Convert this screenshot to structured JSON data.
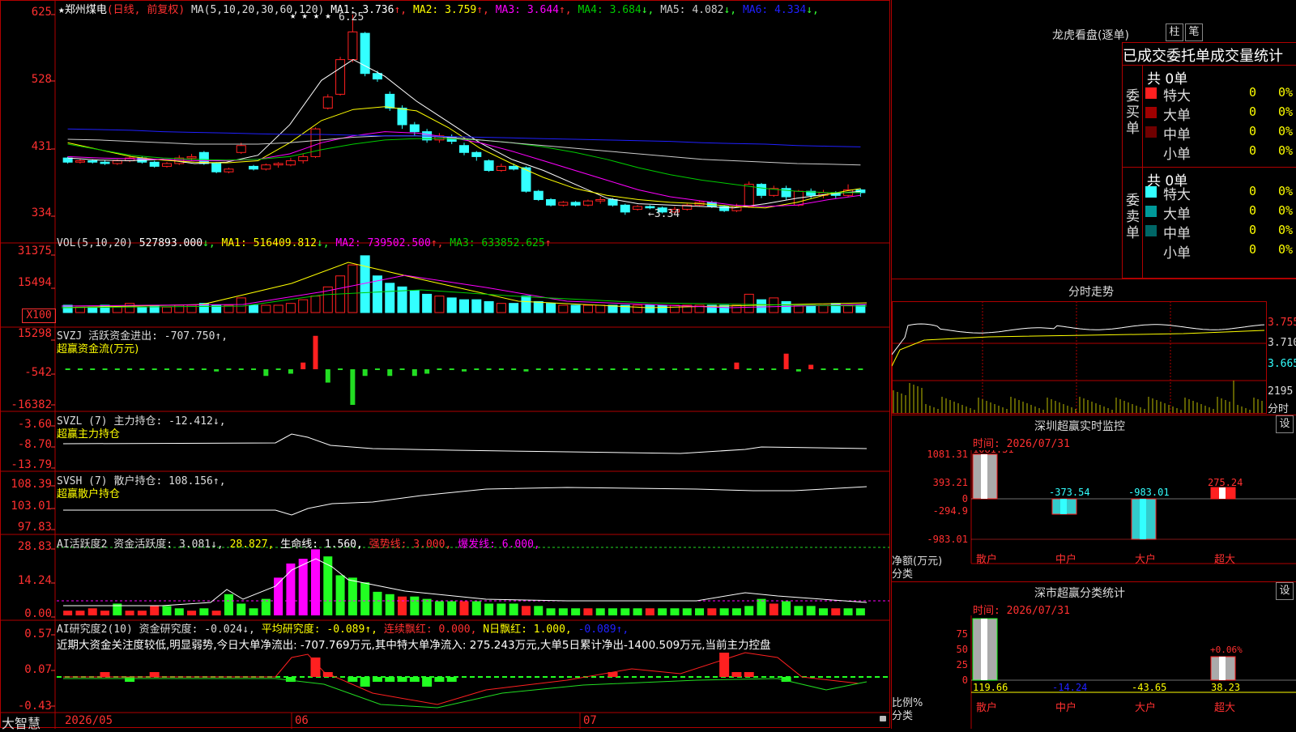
{
  "colors": {
    "up": "#ff2020",
    "down": "#33ffff",
    "axis": "#ff3030",
    "grid": "#b00000",
    "ma1": "#ffffff",
    "ma2": "#ffff00",
    "ma3": "#ff00ff",
    "ma4": "#00cc00",
    "ma5": "#cccccc",
    "ma6": "#2020ff"
  },
  "main": {
    "star": "★",
    "stock": "郑州煤电",
    "mode": "(日线, 前复权)",
    "ma_label": "MA(5,10,20,30,60,120)",
    "ma": [
      {
        "k": "MA1:",
        "v": "3.736",
        "a": "↑",
        "c": "#ffffff"
      },
      {
        "k": "MA2:",
        "v": "3.759",
        "a": "↑",
        "c": "#ffff00"
      },
      {
        "k": "MA3:",
        "v": "3.644",
        "a": "↑",
        "c": "#ff00ff"
      },
      {
        "k": "MA4:",
        "v": "3.684",
        "a": "↓",
        "c": "#00cc00"
      },
      {
        "k": "MA5:",
        "v": "4.082",
        "a": "↓",
        "c": "#cccccc"
      },
      {
        "k": "MA6:",
        "v": "4.334",
        "a": "↓",
        "c": "#2020ff"
      }
    ],
    "yticks": [
      "625",
      "528",
      "431",
      "334"
    ],
    "high_mark": "6.25",
    "low_mark": "←3.34",
    "stars": "★ ★ ★ ★"
  },
  "vol": {
    "label": "VOL(5,10,20)",
    "v": "527893.000",
    "ma1": "MA1: 516409.812",
    "ma2": "MA2: 739502.500",
    "ma3": "MA3: 633852.625",
    "yticks": [
      "31375",
      "15494"
    ],
    "unit": "X100"
  },
  "svzj": {
    "label": "SVZJ  活跃资金进出: -707.750↑,",
    "sub": "超赢资金流(万元)",
    "yticks": [
      "15298",
      "-542",
      "-16382"
    ]
  },
  "svzl": {
    "label": "SVZL (7) 主力持仓: -12.412↓,",
    "sub": "超赢主力持仓",
    "yticks": [
      "-3.60",
      "-8.70",
      "-13.79"
    ]
  },
  "svsh": {
    "label": "SVSH (7) 散户持仓: 108.156↑,",
    "sub": "超赢散户持仓",
    "yticks": [
      "108.39",
      "103.01",
      "97.83"
    ]
  },
  "ai": {
    "label": "AI活跃度2 资金活跃度: 3.081↓,",
    "v2": "28.827,",
    "life": "生命线: 1.560,",
    "strong": "强势线: 3.000,",
    "burst": "爆发线: 6.000,",
    "yticks": [
      "28.83",
      "14.24",
      "0.00"
    ]
  },
  "res": {
    "label": "AI研究度2(10) 资金研究度: -0.024↓,",
    "avg": "平均研究度: -0.089↑,",
    "cont": "连续飘红: 0.000,",
    "nday": "N日飘红: 1.000,",
    "last": "-0.089↑,",
    "comment": "近期大资金关注度较低,明显弱势,今日大单净流出: -707.769万元,其中特大单净流入: 275.243万元,大单5日累计净出-1400.509万元,当前主力控盘",
    "yticks": [
      "0.57",
      "0.07",
      "-0.43"
    ]
  },
  "xaxis": {
    "brand": "大智慧",
    "labels": [
      "2026/05",
      "06",
      "07"
    ]
  },
  "dragon": {
    "title": "龙虎看盘(逐单)",
    "btn1": "柱",
    "btn2": "笔",
    "header": "已成交委托单成交量统计",
    "buy_total": "共 0单",
    "buy_side": "委买单",
    "sell_total": "共 0单",
    "sell_side": "委卖单",
    "buy_rows": [
      {
        "name": "特大",
        "n": "0",
        "p": "0%",
        "c": "#ff2020"
      },
      {
        "name": "大单",
        "n": "0",
        "p": "0%",
        "c": "#a00000"
      },
      {
        "name": "中单",
        "n": "0",
        "p": "0%",
        "c": "#700000"
      },
      {
        "name": "小单",
        "n": "0",
        "p": "0%",
        "c": "#000000"
      }
    ],
    "sell_rows": [
      {
        "name": "特大",
        "n": "0",
        "p": "0%",
        "c": "#33ffff"
      },
      {
        "name": "大单",
        "n": "0",
        "p": "0%",
        "c": "#009999"
      },
      {
        "name": "中单",
        "n": "0",
        "p": "0%",
        "c": "#006666"
      },
      {
        "name": "小单",
        "n": "0",
        "p": "0%",
        "c": "#000000"
      }
    ]
  },
  "intraday": {
    "title": "分时走势",
    "p1": "3.755",
    "p2": "3.710",
    "p3": "3.665",
    "vol": "2195",
    "unit": "分时"
  },
  "monitor": {
    "title": "深圳超赢实时监控",
    "btn": "设",
    "time": "时间: 2026/07/31",
    "yticks": [
      "1081.31",
      "393.21",
      "0",
      "-294.9",
      "-983.01"
    ],
    "ylabel": "净额(万元)",
    "xlabel": "分类",
    "cats": [
      "散户",
      "中户",
      "大户",
      "超大"
    ],
    "vals": [
      "1081.31",
      "-373.54",
      "-983.01",
      "275.24"
    ]
  },
  "classify": {
    "title": "深市超赢分类统计",
    "btn": "设",
    "time": "时间: 2026/07/31",
    "yticks": [
      "75",
      "50",
      "25",
      "0"
    ],
    "ylabel": "比例%",
    "xlabel": "分类",
    "cats": [
      "散户",
      "中户",
      "大户",
      "超大"
    ],
    "vals": [
      "119.66",
      "-14.24",
      "-43.65",
      "38.23"
    ],
    "pct": "+0.06%"
  }
}
